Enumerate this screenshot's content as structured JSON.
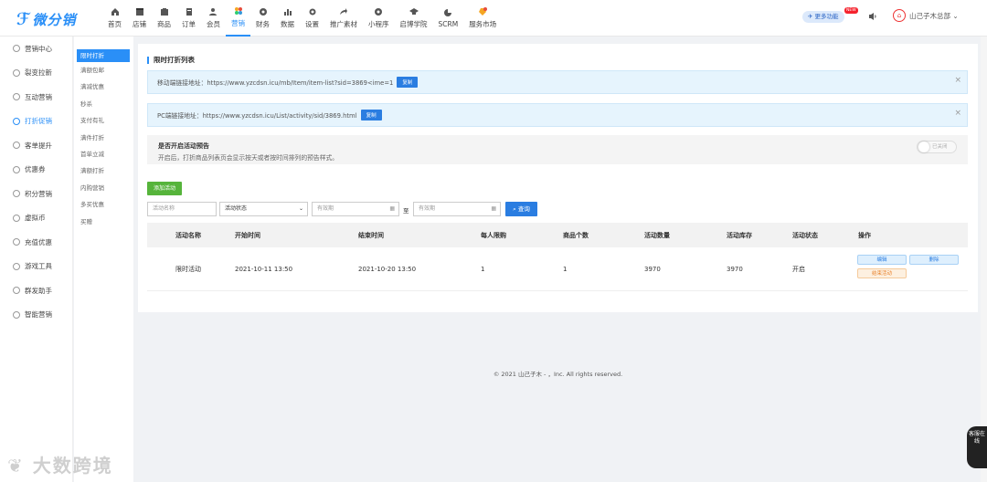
{
  "brand": {
    "logo_text": "微分销",
    "accent": "#2a8ff7"
  },
  "topnav": [
    {
      "label": "首页",
      "icon": "home-icon"
    },
    {
      "label": "店铺",
      "icon": "store-icon"
    },
    {
      "label": "商品",
      "icon": "goods-icon"
    },
    {
      "label": "订单",
      "icon": "order-icon"
    },
    {
      "label": "会员",
      "icon": "member-icon"
    },
    {
      "label": "营销",
      "icon": "marketing-icon",
      "active": true
    },
    {
      "label": "财务",
      "icon": "finance-icon"
    },
    {
      "label": "数据",
      "icon": "data-icon"
    },
    {
      "label": "设置",
      "icon": "settings-icon"
    },
    {
      "label": "推广素材",
      "icon": "share-icon"
    },
    {
      "label": "小程序",
      "icon": "miniapp-icon"
    },
    {
      "label": "启博学院",
      "icon": "academy-icon"
    },
    {
      "label": "SCRM",
      "icon": "scrm-icon"
    },
    {
      "label": "服务市场",
      "icon": "market-icon"
    }
  ],
  "header": {
    "more_label": "更多功能",
    "new_badge": "NEW",
    "user_name": "山己子木总部"
  },
  "sidebar": [
    {
      "label": "营销中心"
    },
    {
      "label": "裂变拉新"
    },
    {
      "label": "互动营销"
    },
    {
      "label": "打折促销",
      "active": true
    },
    {
      "label": "客单提升"
    },
    {
      "label": "优惠券"
    },
    {
      "label": "积分营销"
    },
    {
      "label": "虚拟币"
    },
    {
      "label": "充值优惠"
    },
    {
      "label": "游戏工具"
    },
    {
      "label": "群发助手"
    },
    {
      "label": "智能营销"
    }
  ],
  "subnav": [
    {
      "label": "限时打折",
      "active": true
    },
    {
      "label": "满额包邮"
    },
    {
      "label": "满减优惠"
    },
    {
      "label": "秒杀"
    },
    {
      "label": "支付有礼"
    },
    {
      "label": "满件打折"
    },
    {
      "label": "首单立减"
    },
    {
      "label": "满额打折"
    },
    {
      "label": "内购营销"
    },
    {
      "label": "多买优惠"
    },
    {
      "label": "买赠"
    }
  ],
  "page": {
    "title": "限时打折列表",
    "mobile_link_label": "移动端链接地址：https://www.yzcdsn.icu/mb/Item/item-list?sid=3869<ime=1",
    "pc_link_label": "PC端链接地址：https://www.yzcdsn.icu/List/activity/sid/3869.html",
    "copy_label": "复制",
    "close_label": "×",
    "preview_title": "是否开启活动预告",
    "preview_desc": "开启后，打折商品列表页会显示按天或者按时间排列的预告样式。",
    "toggle_label": "已关闭",
    "add_label": "添加活动",
    "search": {
      "name_placeholder": "活动名称",
      "status_value": "活动状态",
      "start_placeholder": "有效期",
      "end_placeholder": "有效期",
      "to_label": "至",
      "search_label": "查询"
    }
  },
  "table": {
    "columns": [
      "活动名称",
      "开始时间",
      "结束时间",
      "每人限购",
      "商品个数",
      "活动数量",
      "活动库存",
      "活动状态",
      "操作"
    ],
    "rows": [
      {
        "name": "限时活动",
        "start": "2021-10-11 13:50",
        "end": "2021-10-20 13:50",
        "limit": "1",
        "goods": "1",
        "qty": "3970",
        "stock": "3970",
        "status": "开启",
        "edit": "编辑",
        "delete": "删除",
        "end_btn": "结束活动"
      }
    ]
  },
  "footer": {
    "copyright": "© 2021 山己子木 - ，Inc. All rights reserved."
  },
  "watermark": "大数跨境",
  "cs_float": "客服在线"
}
